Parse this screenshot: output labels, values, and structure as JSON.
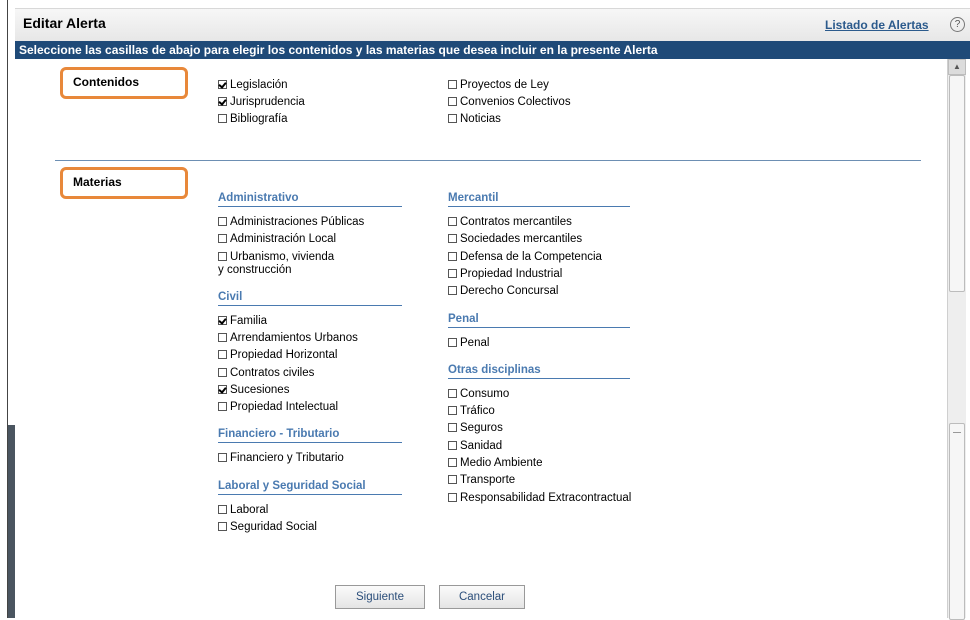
{
  "header": {
    "title": "Editar Alerta",
    "list_link": "Listado de Alertas",
    "help": "?"
  },
  "instructions": "Seleccione las casillas de abajo para elegir los contenidos y las materias que desea incluir en la presente Alerta",
  "contenidos": {
    "label": "Contenidos",
    "items": [
      {
        "label": "Legislación",
        "checked": true
      },
      {
        "label": "Jurisprudencia",
        "checked": true
      },
      {
        "label": "Bibliografía",
        "checked": false
      },
      {
        "label": "Proyectos de Ley",
        "checked": false
      },
      {
        "label": "Convenios Colectivos",
        "checked": false
      },
      {
        "label": "Noticias",
        "checked": false
      }
    ]
  },
  "materias": {
    "label": "Materias",
    "categories": [
      {
        "name": "Administrativo",
        "items": [
          {
            "label": "Administraciones Públicas",
            "checked": false
          },
          {
            "label": "Administración Local",
            "checked": false
          },
          {
            "label": "Urbanismo, vivienda",
            "label2": "y construcción",
            "checked": false
          }
        ]
      },
      {
        "name": "Civil",
        "items": [
          {
            "label": "Familia",
            "checked": true
          },
          {
            "label": "Arrendamientos Urbanos",
            "checked": false
          },
          {
            "label": "Propiedad Horizontal",
            "checked": false
          },
          {
            "label": "Contratos civiles",
            "checked": false
          },
          {
            "label": "Sucesiones",
            "checked": true
          },
          {
            "label": "Propiedad Intelectual",
            "checked": false
          }
        ]
      },
      {
        "name": "Financiero - Tributario",
        "items": [
          {
            "label": "Financiero y Tributario",
            "checked": false
          }
        ]
      },
      {
        "name": "Laboral y Seguridad Social",
        "items": [
          {
            "label": "Laboral",
            "checked": false
          },
          {
            "label": "Seguridad Social",
            "checked": false
          }
        ]
      },
      {
        "name": "Mercantil",
        "items": [
          {
            "label": "Contratos mercantiles",
            "checked": false
          },
          {
            "label": "Sociedades mercantiles",
            "checked": false
          },
          {
            "label": "Defensa de la Competencia",
            "checked": false
          },
          {
            "label": "Propiedad Industrial",
            "checked": false
          },
          {
            "label": "Derecho Concursal",
            "checked": false
          }
        ]
      },
      {
        "name": "Penal",
        "items": [
          {
            "label": "Penal",
            "checked": false
          }
        ]
      },
      {
        "name": "Otras disciplinas",
        "items": [
          {
            "label": "Consumo",
            "checked": false
          },
          {
            "label": "Tráfico",
            "checked": false
          },
          {
            "label": "Seguros",
            "checked": false
          },
          {
            "label": "Sanidad",
            "checked": false
          },
          {
            "label": "Medio Ambiente",
            "checked": false
          },
          {
            "label": "Transporte",
            "checked": false
          },
          {
            "label": "Responsabilidad Extracontractual",
            "checked": false
          }
        ]
      }
    ]
  },
  "buttons": {
    "next": "Siguiente",
    "cancel": "Cancelar"
  },
  "colors": {
    "header_bar": "#1f4a78",
    "accent_box": "#e8883a",
    "category": "#4a7ab0"
  }
}
